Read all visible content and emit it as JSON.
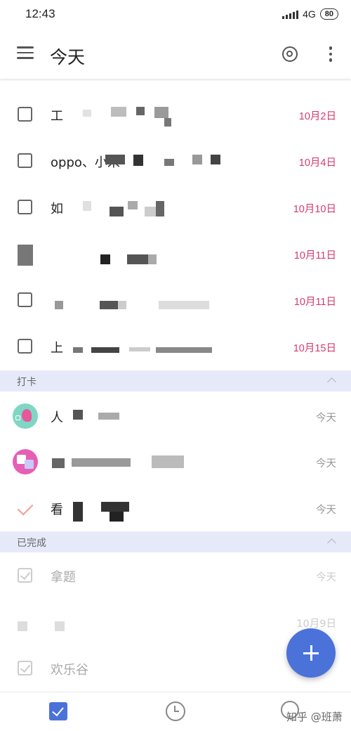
{
  "status_bar": {
    "time": "12:43",
    "network": "4G",
    "battery": "80"
  },
  "app_bar": {
    "title": "今天",
    "menu_icon": "hamburger-menu-icon",
    "focus_icon": "target-icon",
    "more_icon": "more-vert-icon"
  },
  "tasks": [
    {
      "title": "工 ",
      "date": "10月2日"
    },
    {
      "title": "oppo、小米",
      "date": "10月4日"
    },
    {
      "title": "如",
      "date": "10月10日"
    },
    {
      "title": "",
      "date": "10月11日"
    },
    {
      "title": "",
      "date": "10月11日"
    },
    {
      "title": "上",
      "date": "10月15日"
    }
  ],
  "habit_section": {
    "label": "打卡"
  },
  "habits": [
    {
      "title": "人",
      "status": "今天",
      "icon": "head-avatar-icon",
      "color": "#7fd6c3"
    },
    {
      "title": "",
      "status": "今天",
      "icon": "translate-avatar-icon",
      "color": "#e65fb5"
    },
    {
      "title": "看",
      "status": "今天",
      "icon": "check-mark-icon",
      "color": "#ef9e92"
    }
  ],
  "done_section": {
    "label": "已完成"
  },
  "done": [
    {
      "title": "拿题",
      "status": "今天"
    },
    {
      "title": "",
      "status": "10月9日"
    },
    {
      "title": "欢乐谷",
      "status": ""
    }
  ],
  "bottom_nav": {
    "tasks_icon": "checkbox-icon",
    "clock_icon": "clock-icon",
    "search_icon": "search-icon"
  },
  "watermark": "知乎 @班萧",
  "colors": {
    "accent": "#4a72d9",
    "date": "#d43b70",
    "section_bg": "#e6eaf8"
  }
}
